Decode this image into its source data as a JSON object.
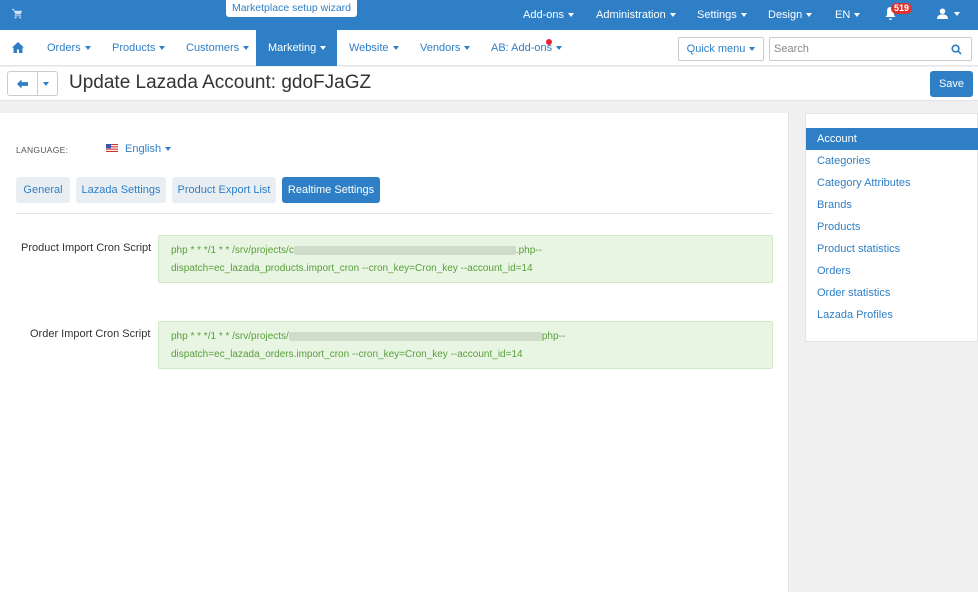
{
  "topbar": {
    "wizard": "Marketplace setup wizard",
    "menus": [
      "Add-ons",
      "Administration",
      "Settings",
      "Design",
      "EN"
    ],
    "notification_count": "519"
  },
  "mainnav": {
    "items": [
      "Orders",
      "Products",
      "Customers",
      "Marketing",
      "Website",
      "Vendors",
      "AB: Add-ons"
    ],
    "active": "Marketing",
    "quick_menu": "Quick menu",
    "search_placeholder": "Search"
  },
  "titlebar": {
    "title": "Update Lazada Account: gdoFJaGZ",
    "save": "Save"
  },
  "form": {
    "language_label": "LANGUAGE:",
    "language_value": "English",
    "tabs": [
      "General",
      "Lazada Settings",
      "Product Export List",
      "Realtime Settings"
    ],
    "active_tab": "Realtime Settings",
    "fields": [
      {
        "label": "Product Import Cron Script",
        "line1_prefix": "php * * */1 * * /srv/projects/c",
        "line1_suffix": ".php--",
        "line2": "dispatch=ec_lazada_products.import_cron --cron_key=Cron_key --account_id=14"
      },
      {
        "label": "Order Import Cron Script",
        "line1_prefix": "php * * */1 * * /srv/projects/",
        "line1_suffix": "php--",
        "line2": "dispatch=ec_lazada_orders.import_cron --cron_key=Cron_key --account_id=14"
      }
    ]
  },
  "sidebar": {
    "items": [
      "Account",
      "Categories",
      "Category Attributes",
      "Brands",
      "Products",
      "Product statistics",
      "Orders",
      "Order statistics",
      "Lazada Profiles"
    ],
    "active": "Account"
  },
  "colors": {
    "brand": "#2f7fc6",
    "code_bg": "#e8f5e2",
    "code_text": "#5a9e3e"
  }
}
